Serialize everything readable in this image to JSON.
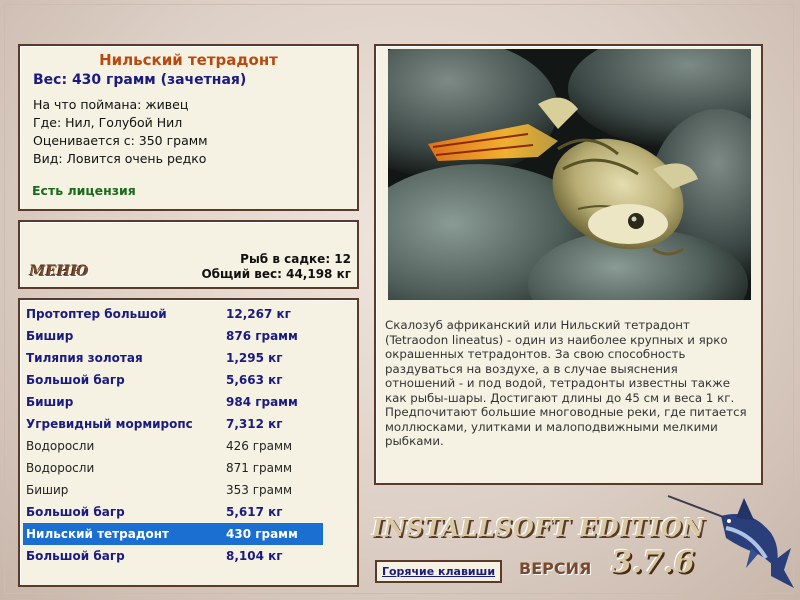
{
  "catch": {
    "fish_name": "Нильский тетрадонт",
    "weight": "Вес: 430 грамм (зачетная)",
    "bait": "На что поймана: живец",
    "location": "Где: Нил, Голубой Нил",
    "valued_from": "Оценивается с: 350 грамм",
    "rarity": "Вид: Ловится очень редко",
    "license": "Есть лицензия"
  },
  "cage": {
    "menu_label": "МЕНЮ",
    "fish_count": "Рыб в садке: 12",
    "total_weight": "Общий вес: 44,198 кг"
  },
  "fish_list": [
    {
      "name": "Протоптер большой",
      "weight": "12,267 кг",
      "style": "bold"
    },
    {
      "name": "Бишир",
      "weight": "876 грамм",
      "style": "bold"
    },
    {
      "name": "Тиляпия золотая",
      "weight": "1,295 кг",
      "style": "bold"
    },
    {
      "name": "Большой багр",
      "weight": "5,663 кг",
      "style": "bold"
    },
    {
      "name": "Бишир",
      "weight": "984 грамм",
      "style": "bold"
    },
    {
      "name": "Угревидный мормиропс",
      "weight": "7,312 кг",
      "style": "bold"
    },
    {
      "name": "Водоросли",
      "weight": "426 грамм",
      "style": "plain"
    },
    {
      "name": "Водоросли",
      "weight": "871 грамм",
      "style": "plain"
    },
    {
      "name": "Бишир",
      "weight": "353 грамм",
      "style": "plain"
    },
    {
      "name": "Большой багр",
      "weight": "5,617 кг",
      "style": "bold"
    },
    {
      "name": "Нильский тетрадонт",
      "weight": "430 грамм",
      "style": "selected"
    },
    {
      "name": "Большой багр",
      "weight": "8,104 кг",
      "style": "bold"
    }
  ],
  "description": "Скалозуб африканский или Нильский тетрадонт (Tetraodon lineatus) - один из наиболее крупных и ярко окрашенных тетрадонтов. За свою способность раздуваться на воздухе, а в случае выяснения отношений - и под водой, тетрадонты известны также как рыбы-шары. Достигают длины до 45 см и веса 1 кг. Предпочитают большие многоводные реки, где питается моллюсками, улитками и малоподвижными мелкими рыбками.",
  "branding": {
    "edition": "INSTALLSOFT EDITION",
    "version_label": "ВЕРСИЯ",
    "version_number": "3.7.6"
  },
  "hotkeys_label": "Горячие клавиши",
  "colors": {
    "panel_bg": "#f5f2e3",
    "panel_border": "#5c3a2a",
    "title_orange": "#b84a10",
    "text_blue": "#1a1a80",
    "license_green": "#1a6a1a",
    "selection_blue": "#1a6fd0"
  }
}
